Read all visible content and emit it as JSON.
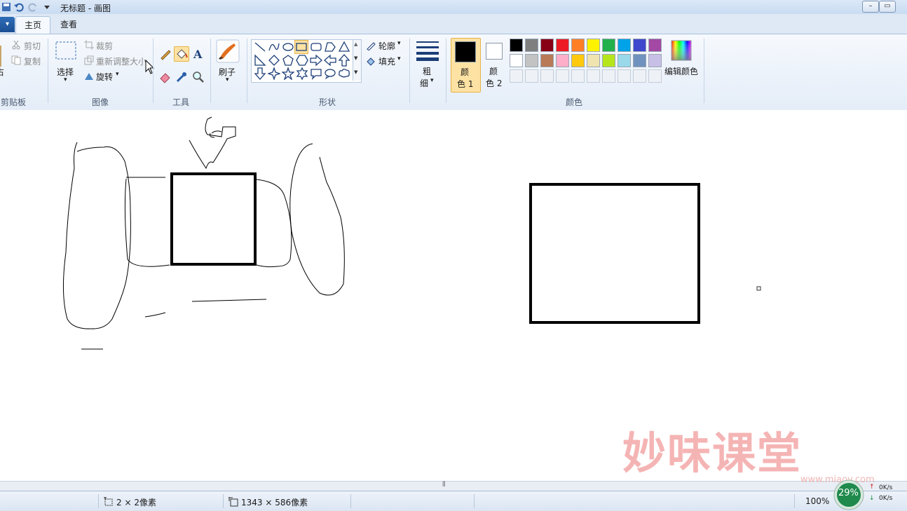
{
  "window": {
    "title": "无标题 - 画图"
  },
  "tabs": {
    "file": "▾",
    "home": "主页",
    "view": "查看"
  },
  "clipboard": {
    "paste_partial": "占",
    "cut": "剪切",
    "copy": "复制",
    "label": "剪贴板"
  },
  "image": {
    "select": "选择",
    "crop": "裁剪",
    "resize": "重新调整大小",
    "rotate": "旋转",
    "label": "图像"
  },
  "tools": {
    "label": "工具"
  },
  "brushes": {
    "label": "刷子"
  },
  "shapes": {
    "outline": "轮廓",
    "fill": "填充",
    "label": "形状"
  },
  "size": {
    "label1": "粗",
    "label2": "细"
  },
  "colors": {
    "color1_a": "颜",
    "color1_b": "色 1",
    "color2_a": "颜",
    "color2_b": "色 2",
    "edit": "编辑颜色",
    "label": "颜色",
    "color1_value": "#000000",
    "color2_value": "#ffffff",
    "palette_row1": [
      "#000000",
      "#7f7f7f",
      "#880015",
      "#ed1c24",
      "#ff7f27",
      "#fff200",
      "#22b14c",
      "#00a2e8",
      "#3f48cc",
      "#a349a4"
    ],
    "palette_row2": [
      "#ffffff",
      "#c3c3c3",
      "#b97a57",
      "#ffaec9",
      "#ffc90e",
      "#efe4b0",
      "#b5e61d",
      "#99d9ea",
      "#7092be",
      "#c8bfe7"
    ]
  },
  "status": {
    "selection_size": "2 × 2像素",
    "canvas_size": "1343 × 586像素",
    "zoom": "100%"
  },
  "watermark": {
    "text": "妙味课堂",
    "url": "www.miaov.com"
  },
  "speed_widget": {
    "percent": "29%",
    "up": "0K/s",
    "down": "0K/s"
  }
}
